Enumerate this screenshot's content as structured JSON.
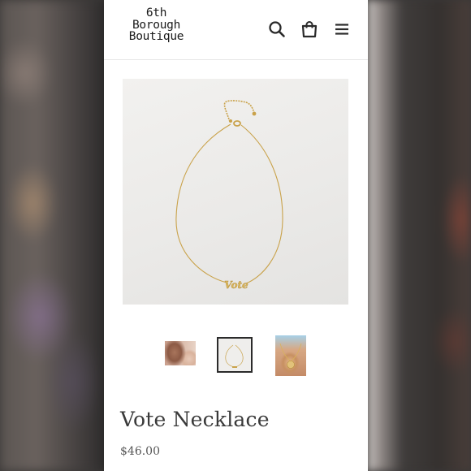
{
  "header": {
    "logo_lines": [
      "6th",
      "Borough",
      "Boutique"
    ],
    "icons": [
      "search-icon",
      "shopping-bag-icon",
      "hamburger-menu-icon"
    ]
  },
  "product": {
    "title": "Vote Necklace",
    "price": "$46.00",
    "pendant_text": "Vote",
    "thumbnails": [
      {
        "name": "model-wearing-necklace",
        "selected": false
      },
      {
        "name": "necklace-flat-lay",
        "selected": true
      },
      {
        "name": "model-neck-closeup",
        "selected": false
      }
    ]
  },
  "colors": {
    "text": "#3a3a3a",
    "gold": "#c9a24a",
    "selected_border": "#2b2b2b"
  }
}
